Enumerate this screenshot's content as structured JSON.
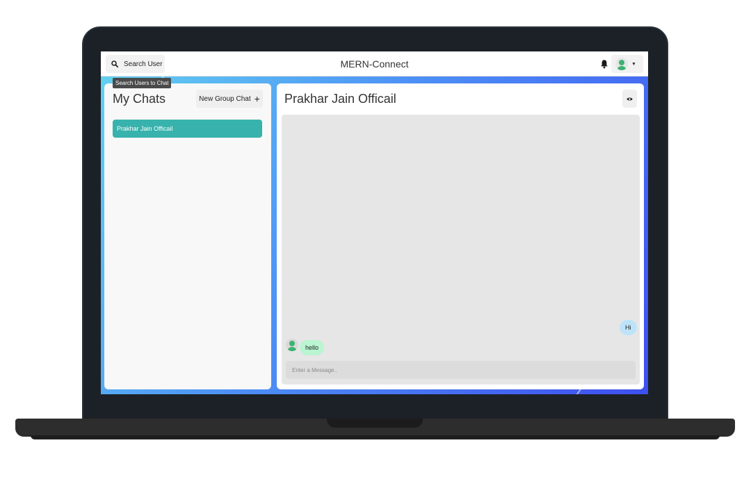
{
  "header": {
    "search_label": "Search User",
    "search_tooltip": "Search Users to Chat",
    "app_title": "MERN-Connect",
    "icons": {
      "search": "search-icon",
      "bell": "bell-icon",
      "avatar": "user-avatar-icon",
      "chevron": "chevron-down-icon"
    }
  },
  "sidebar": {
    "title": "My Chats",
    "new_group_label": "New Group Chat",
    "new_group_icon": "+",
    "chats": [
      {
        "name": "Prakhar Jain Officail",
        "selected": true
      }
    ]
  },
  "conversation": {
    "title": "Prakhar Jain Officail",
    "view_profile_icon": "eye-icon",
    "messages": [
      {
        "text": "Hi",
        "from": "me"
      },
      {
        "text": "hello",
        "from": "other"
      }
    ],
    "input_placeholder": "Enter a Message..",
    "input_value": ""
  },
  "colors": {
    "selected_chat": "#38b2ac",
    "own_bubble": "#bee3f8",
    "other_bubble": "#b9f5d0"
  }
}
